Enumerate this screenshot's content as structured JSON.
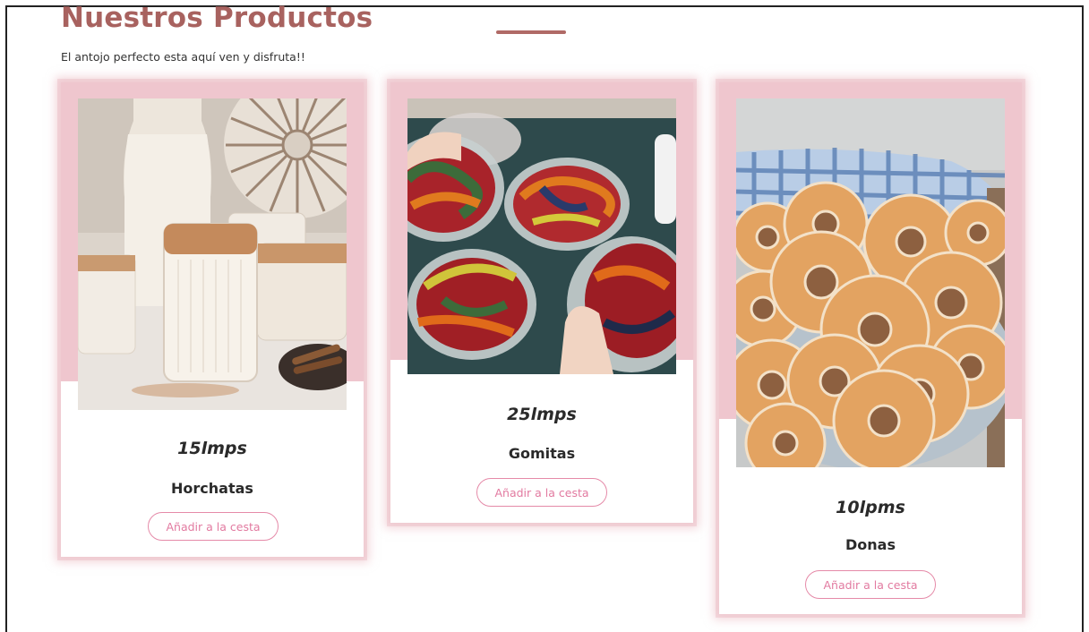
{
  "section": {
    "title": "Nuestros Productos",
    "subtitle": "El antojo perfecto esta aquí ven y disfruta!!"
  },
  "products": [
    {
      "price": "15lmps",
      "name": "Horchatas",
      "button": "Añadir a la cesta",
      "image": "horchata-glasses-photo"
    },
    {
      "price": "25lmps",
      "name": "Gomitas",
      "button": "Añadir a la cesta",
      "image": "gummy-worms-cups-photo"
    },
    {
      "price": "10lpms",
      "name": "Donas",
      "button": "Añadir a la cesta",
      "image": "sugar-donuts-plate-photo"
    }
  ],
  "colors": {
    "title": "#a8625f",
    "accent": "#e27aa0",
    "card_glow": "#efc6ce"
  }
}
